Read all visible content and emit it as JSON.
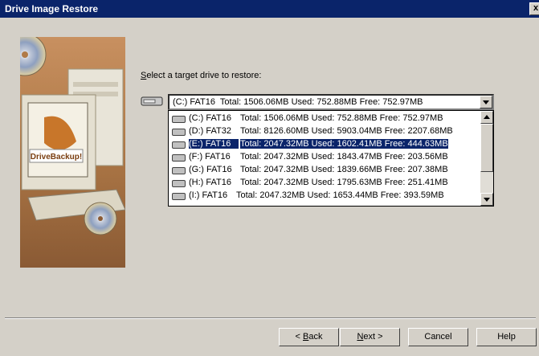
{
  "window": {
    "title": "Drive Image Restore",
    "close_label": "x"
  },
  "art": {
    "brand": "DriveBackup!"
  },
  "prompt": {
    "mnemonic": "S",
    "text": "elect a target drive to restore:"
  },
  "combo": {
    "selected": {
      "drive": "(C:) FAT16",
      "stats": "Total: 1506.06MB Used: 752.88MB Free: 752.97MB"
    }
  },
  "list": {
    "items": [
      {
        "drive": "(C:) FAT16",
        "stats": "Total: 1506.06MB Used: 752.88MB Free: 752.97MB",
        "selected": false
      },
      {
        "drive": "(D:) FAT32",
        "stats": "Total: 8126.60MB Used: 5903.04MB Free: 2207.68MB",
        "selected": false
      },
      {
        "drive": "(E:) FAT16",
        "stats": "Total: 2047.32MB Used: 1602.41MB Free: 444.63MB",
        "selected": true
      },
      {
        "drive": "(F:) FAT16",
        "stats": "Total: 2047.32MB Used: 1843.47MB Free: 203.56MB",
        "selected": false
      },
      {
        "drive": "(G:) FAT16",
        "stats": "Total: 2047.32MB Used: 1839.66MB Free: 207.38MB",
        "selected": false
      },
      {
        "drive": "(H:) FAT16",
        "stats": "Total: 2047.32MB Used: 1795.63MB Free: 251.41MB",
        "selected": false
      },
      {
        "drive": "(I:) FAT16",
        "stats": "Total: 2047.32MB Used: 1653.44MB Free: 393.59MB",
        "selected": false
      }
    ]
  },
  "buttons": {
    "back": {
      "mnemonic": "B",
      "prefix": "< ",
      "rest": "ack"
    },
    "next": {
      "mnemonic": "N",
      "rest": "ext >"
    },
    "cancel": "Cancel",
    "help": "Help"
  }
}
